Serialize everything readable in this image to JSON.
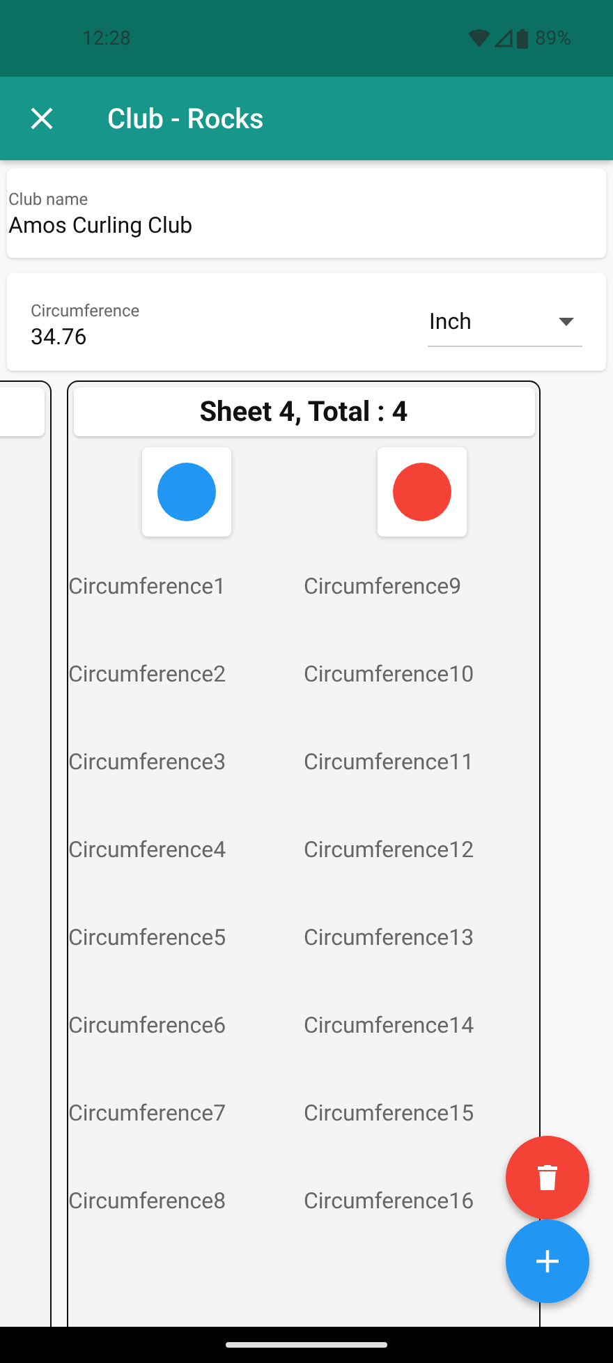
{
  "status_bar": {
    "time": "12:28",
    "battery": "89%"
  },
  "app_bar": {
    "title": "Club - Rocks"
  },
  "club_name": {
    "label": "Club name",
    "value": "Amos Curling Club"
  },
  "circumference": {
    "label": "Circumference",
    "value": "34.76",
    "unit": "Inch"
  },
  "sheet": {
    "title": "Sheet 4, Total : 4",
    "stones": [
      {
        "color": "#2196f3",
        "items": [
          "Circumference1",
          "Circumference2",
          "Circumference3",
          "Circumference4",
          "Circumference5",
          "Circumference6",
          "Circumference7",
          "Circumference8"
        ]
      },
      {
        "color": "#f44336",
        "items": [
          "Circumference9",
          "Circumference10",
          "Circumference11",
          "Circumference12",
          "Circumference13",
          "Circumference14",
          "Circumference15",
          "Circumference16"
        ]
      }
    ]
  }
}
